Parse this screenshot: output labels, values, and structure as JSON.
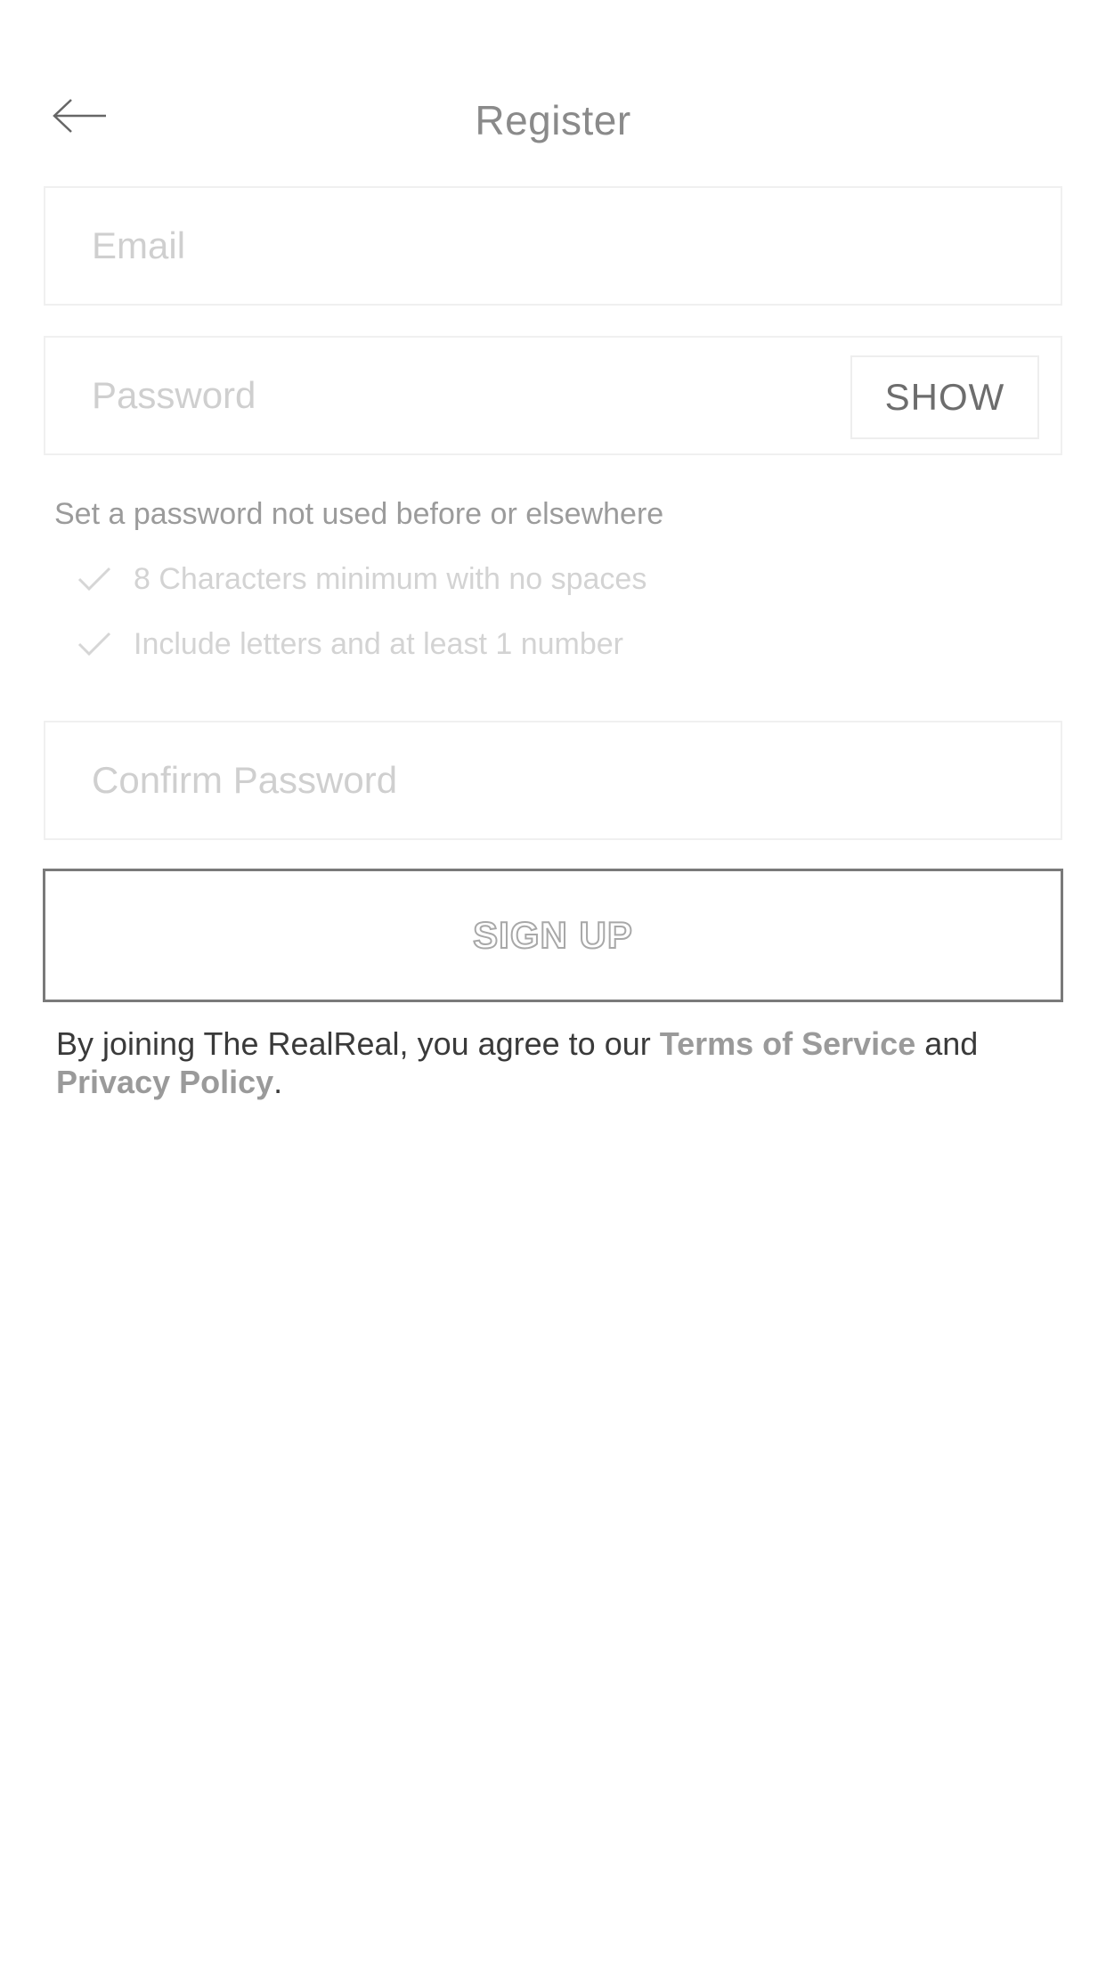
{
  "header": {
    "title": "Register",
    "back_icon": "arrow-left-icon"
  },
  "form": {
    "email": {
      "placeholder": "Email",
      "value": ""
    },
    "password": {
      "placeholder": "Password",
      "value": "",
      "show_label": "SHOW"
    },
    "hints": {
      "title": "Set a password not used before or elsewhere",
      "rules": [
        {
          "label": "8 Characters minimum with no spaces",
          "icon": "check-icon"
        },
        {
          "label": "Include letters and at least 1 number",
          "icon": "check-icon"
        }
      ]
    },
    "confirm_password": {
      "placeholder": "Confirm Password",
      "value": ""
    },
    "submit_label": "SIGN UP"
  },
  "legal": {
    "prefix": "By joining The RealReal, you agree to our ",
    "terms_label": "Terms of Service",
    "connector": " and ",
    "privacy_label": "Privacy Policy",
    "suffix": "."
  },
  "colors": {
    "title": "#8a8a8a",
    "placeholder": "#cfcfcf",
    "hint_text": "#9b9b9b",
    "rule_text": "#d3d3d3",
    "button_border": "#7a7a7a",
    "link": "#9a9a9a",
    "body_text": "#3a3a3a"
  }
}
